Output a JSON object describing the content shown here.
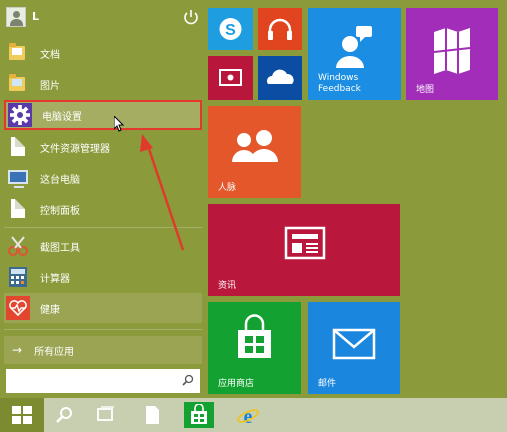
{
  "user": {
    "name": "L"
  },
  "menu_items": [
    {
      "label": "文档",
      "icon": "folder-documents-icon"
    },
    {
      "label": "图片",
      "icon": "folder-pictures-icon"
    },
    {
      "label": "电脑设置",
      "icon": "gear-icon",
      "highlighted": true
    },
    {
      "label": "文件资源管理器",
      "icon": "document-icon"
    },
    {
      "label": "这台电脑",
      "icon": "computer-icon"
    },
    {
      "label": "控制面板",
      "icon": "document-icon"
    },
    {
      "label": "截图工具",
      "icon": "scissors-icon"
    },
    {
      "label": "计算器",
      "icon": "calculator-icon"
    },
    {
      "label": "健康",
      "icon": "heart-icon"
    }
  ],
  "all_apps": {
    "label": "所有应用",
    "arrow": "→"
  },
  "search": {
    "placeholder": ""
  },
  "tiles": [
    {
      "label": "",
      "icon": "skype-icon",
      "color": "#1e9ee0"
    },
    {
      "label": "",
      "icon": "headphones-icon",
      "color": "#e0451f"
    },
    {
      "label": "Windows Feedback",
      "icon": "people-feedback-icon",
      "color": "#1b8de3"
    },
    {
      "label": "地图",
      "icon": "map-icon",
      "color": "#a22db8"
    },
    {
      "label": "",
      "icon": "video-icon",
      "color": "#b8163a"
    },
    {
      "label": "",
      "icon": "onedrive-icon",
      "color": "#0b4da3"
    },
    {
      "label": "人脉",
      "icon": "people-icon",
      "color": "#e3572b"
    },
    {
      "label": "资讯",
      "icon": "news-icon",
      "color": "#b9183c"
    },
    {
      "label": "应用商店",
      "icon": "store-icon",
      "color": "#13a132"
    },
    {
      "label": "邮件",
      "icon": "mail-icon",
      "color": "#1b86de"
    }
  ],
  "taskbar": [
    {
      "icon": "windows-start-icon"
    },
    {
      "icon": "search-icon"
    },
    {
      "icon": "task-view-icon"
    },
    {
      "icon": "file-icon"
    },
    {
      "icon": "store-icon"
    },
    {
      "icon": "internet-explorer-icon"
    }
  ],
  "colors": {
    "accent": "#8b9a3b",
    "highlight_border": "#e5382c"
  }
}
